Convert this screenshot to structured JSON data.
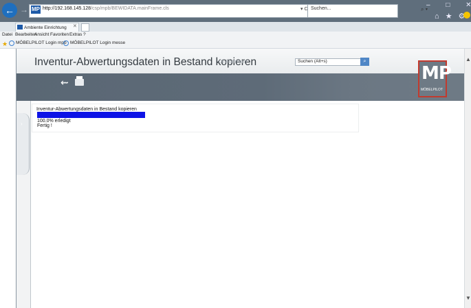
{
  "browser": {
    "url_host": "http://192.168.145.128",
    "url_path": "/csp/mpb/BEWIDATA.mainFrame.cls",
    "url_controls": "▾ C",
    "search_placeholder": "Suchen...",
    "window_controls": "– □ ✕",
    "toolbar_icons": "⌂ ★ ⚙",
    "tab_label": "Ambiente Einrichtung",
    "tab_close": "✕"
  },
  "menu": [
    "Datei",
    "Bearbeiten",
    "Ansicht",
    "Favoriten",
    "Extras",
    "?"
  ],
  "favorites": [
    "MÖBELPILOT Login mpb",
    "MÖBELPILOT Login messe"
  ],
  "app": {
    "title": "Inventur-Abwertungsdaten in Bestand kopieren",
    "user": "Uli Flottmann",
    "search_label": "Suchen (Alt+s)",
    "search_button_icon": "search-icon",
    "logo_text": "MP",
    "logo_sub": "MÖBELPILOT"
  },
  "progress": {
    "title": "Inventur-Abwertungsdaten in Bestand kopieren",
    "percent_text": "100.0% erledigt",
    "fraction": 1.0,
    "status": "Fertig !"
  },
  "colors": {
    "accent": "#1d5aa8",
    "progress_bar": "#0d13e6",
    "logo_border": "#c23a2e"
  }
}
